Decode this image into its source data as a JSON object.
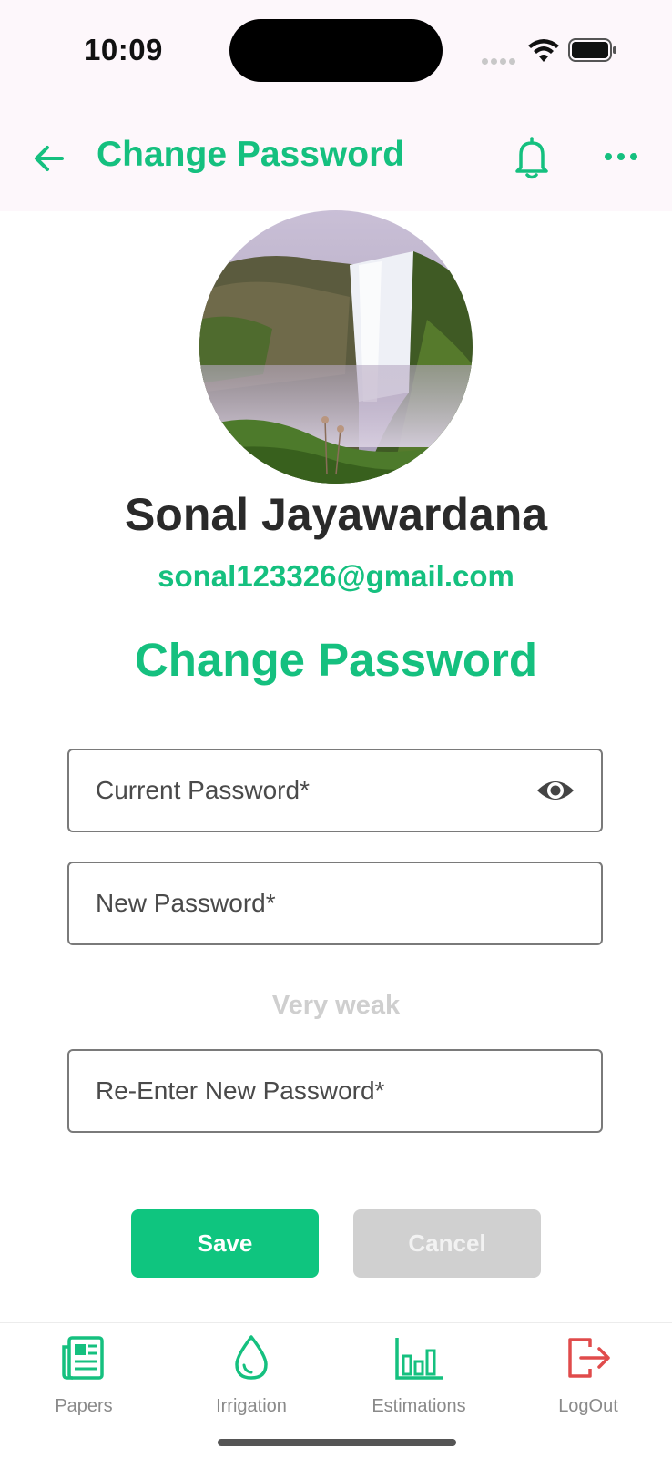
{
  "status_bar": {
    "time": "10:09"
  },
  "app_bar": {
    "title": "Change Password"
  },
  "profile": {
    "name": "Sonal Jayawardana",
    "email": "sonal123326@gmail.com"
  },
  "form": {
    "section_title": "Change Password",
    "current_password_placeholder": "Current Password*",
    "new_password_placeholder": "New Password*",
    "strength_label": "Very weak",
    "reenter_password_placeholder": "Re-Enter New Password*",
    "save_label": "Save",
    "cancel_label": "Cancel"
  },
  "bottom_nav": {
    "items": [
      {
        "label": "Papers",
        "icon": "newspaper-icon"
      },
      {
        "label": "Irrigation",
        "icon": "water-drop-icon"
      },
      {
        "label": "Estimations",
        "icon": "bar-chart-icon"
      },
      {
        "label": "LogOut",
        "icon": "logout-icon"
      }
    ]
  },
  "colors": {
    "accent": "#15c07f",
    "logout": "#e04b4b",
    "app_bar_bg": "#fdf7fb"
  }
}
